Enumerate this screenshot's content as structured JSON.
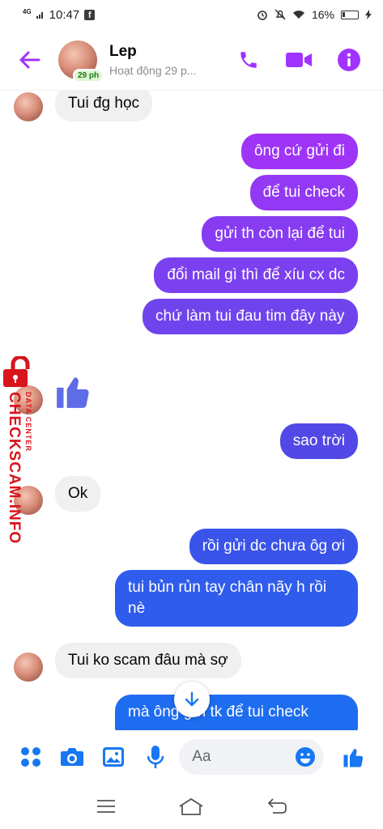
{
  "status_bar": {
    "network": "4G",
    "time": "10:47",
    "battery_text": "16%"
  },
  "header": {
    "name": "Lep",
    "status": "Hoạt động 29 p...",
    "active_badge": "29 ph",
    "colors": {
      "accent": "#a033ff"
    }
  },
  "messages": [
    {
      "sender": "them",
      "text": "Tui đg học"
    },
    {
      "sender": "me",
      "text": "ông cứ gửi đi"
    },
    {
      "sender": "me",
      "text": "để tui check"
    },
    {
      "sender": "me",
      "text": "gửi th còn lại để tui"
    },
    {
      "sender": "me",
      "text": "đổi mail gì thì để xíu cx dc"
    },
    {
      "sender": "me",
      "text": "chứ làm tui đau tim đây này"
    },
    {
      "sender": "them",
      "type": "like"
    },
    {
      "sender": "me",
      "text": "sao trời"
    },
    {
      "sender": "them",
      "text": "Ok"
    },
    {
      "sender": "me",
      "text": "rồi gửi dc chưa ôg ơi"
    },
    {
      "sender": "me",
      "text": "tui bủn rủn tay chân nãy h rồi nè"
    },
    {
      "sender": "them",
      "text": "Tui ko scam đâu mà sợ"
    },
    {
      "sender": "me",
      "text": "mà ông gửi tk để tui check"
    }
  ],
  "composer": {
    "placeholder": "Aa",
    "icons": [
      "menu-dots-icon",
      "camera-icon",
      "image-icon",
      "microphone-icon",
      "emoji-icon",
      "thumbs-up-icon"
    ]
  },
  "watermark": {
    "main": "CHECKSCAM.INFO",
    "sub": "DATA CENTER"
  },
  "navbar": {
    "icons": [
      "recents-icon",
      "home-icon",
      "back-icon"
    ]
  }
}
